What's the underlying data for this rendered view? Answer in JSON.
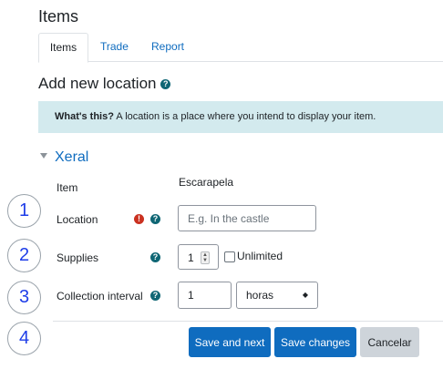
{
  "page": {
    "title": "Items"
  },
  "tabs": [
    {
      "label": "Items",
      "active": true
    },
    {
      "label": "Trade",
      "active": false
    },
    {
      "label": "Report",
      "active": false
    }
  ],
  "section": {
    "title": "Add new location",
    "help_icon": "question-circle-icon"
  },
  "infobox": {
    "bold": "What's this?",
    "text": " A location is a place where you intend to display your item."
  },
  "fieldset": {
    "title": "Xeral",
    "expanded": true
  },
  "form": {
    "item": {
      "label": "Item",
      "value": "Escarapela"
    },
    "location": {
      "label": "Location",
      "placeholder": "E.g. In the castle",
      "value": "",
      "required_icon": "exclamation-circle-icon",
      "help_icon": "question-circle-icon"
    },
    "supplies": {
      "label": "Supplies",
      "value": "1",
      "unlimited_label": "Unlimited",
      "unlimited_checked": false,
      "help_icon": "question-circle-icon"
    },
    "collection_interval": {
      "label": "Collection interval",
      "value": "1",
      "unit": "horas",
      "help_icon": "question-circle-icon"
    }
  },
  "buttons": {
    "save_next": "Save and next",
    "save_changes": "Save changes",
    "cancel": "Cancelar"
  },
  "annotations": [
    "1",
    "2",
    "3",
    "4"
  ],
  "colors": {
    "accent": "#0f6cbf",
    "info_bg": "#d3eaee",
    "help_icon": "#0f6674",
    "error_icon": "#ca3120",
    "annotation": "#1f3ee8"
  }
}
